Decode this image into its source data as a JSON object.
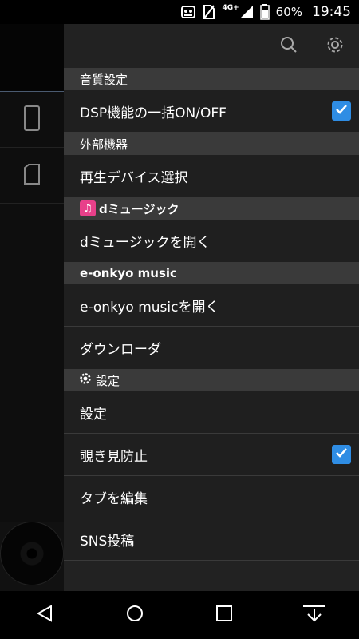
{
  "status_bar": {
    "network": "4G+",
    "battery": "60%",
    "time": "19:45"
  },
  "drawer": {
    "sections": [
      {
        "title": "音質設定",
        "items": [
          {
            "label": "DSP機能の一括ON/OFF",
            "checked": true
          }
        ]
      },
      {
        "title": "外部機器",
        "items": [
          {
            "label": "再生デバイス選択"
          }
        ]
      },
      {
        "title_logo": "dミュージック",
        "items": [
          {
            "label": "dミュージックを開く"
          }
        ]
      },
      {
        "title_logo": "e-onkyo music",
        "items": [
          {
            "label": "e-onkyo musicを開く"
          },
          {
            "label": "ダウンローダ"
          }
        ]
      },
      {
        "title": "設定",
        "items": [
          {
            "label": "設定"
          },
          {
            "label": "覗き見防止",
            "checked": true
          },
          {
            "label": "タブを編集"
          },
          {
            "label": "SNS投稿"
          }
        ]
      }
    ]
  },
  "colors": {
    "checkbox": "#2f8de4",
    "section_bg": "#3a3a3a",
    "item_bg": "#1f1f1f",
    "dmusic_pink": "#e8408a"
  }
}
